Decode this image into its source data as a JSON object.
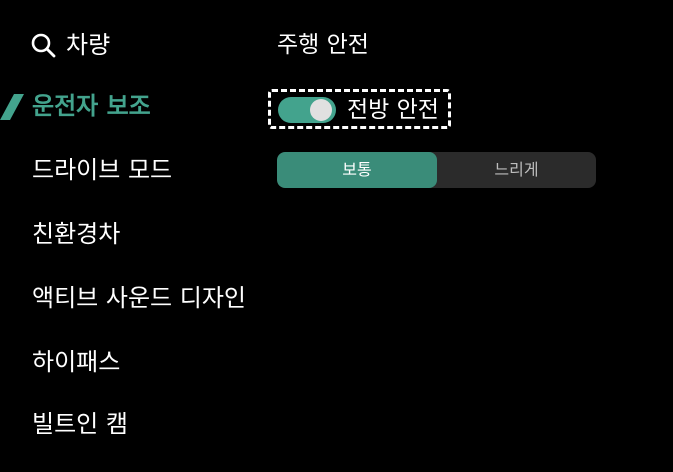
{
  "sidebar": {
    "search_label": "차량",
    "items": [
      {
        "label": "운전자 보조",
        "active": true
      },
      {
        "label": "드라이브 모드",
        "active": false
      },
      {
        "label": "친환경차",
        "active": false
      },
      {
        "label": "액티브 사운드 디자인",
        "active": false
      },
      {
        "label": "하이패스",
        "active": false
      },
      {
        "label": "빌트인 캠",
        "active": false
      }
    ]
  },
  "main": {
    "section_title": "주행 안전",
    "forward_safety": {
      "label": "전방 안전",
      "enabled": true
    },
    "sensitivity": {
      "options": [
        "보통",
        "느리게"
      ],
      "selected": "보통"
    }
  },
  "colors": {
    "background": "#000000",
    "accent": "#43a38d",
    "segment_selected": "#3a8c79",
    "segment_bg": "#2b2b2b",
    "text": "#ffffff",
    "muted_text": "#bdbdbd"
  },
  "icons": {
    "search": "search-icon",
    "active_marker": "active-indicator-slash"
  }
}
